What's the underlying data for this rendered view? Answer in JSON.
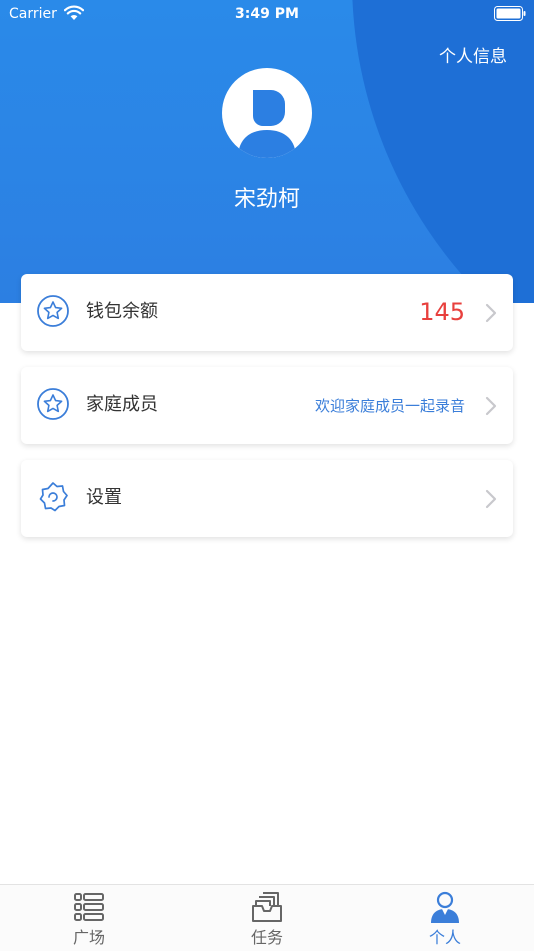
{
  "status_bar": {
    "carrier": "Carrier",
    "time": "3:49 PM"
  },
  "header": {
    "profile_info_link": "个人信息",
    "user_name": "宋劲柯"
  },
  "menu": [
    {
      "label": "钱包余额",
      "value": "145",
      "icon": "star-badge-icon"
    },
    {
      "label": "家庭成员",
      "value": "欢迎家庭成员一起录音",
      "icon": "star-badge-icon"
    },
    {
      "label": "设置",
      "value": "",
      "icon": "gear-icon"
    }
  ],
  "tab_bar": {
    "tabs": [
      {
        "label": "广场",
        "icon": "list-icon",
        "active": false
      },
      {
        "label": "任务",
        "icon": "inbox-stack-icon",
        "active": false
      },
      {
        "label": "个人",
        "icon": "person-icon",
        "active": true
      }
    ]
  },
  "colors": {
    "header_blue": "#2a8ae9",
    "accent_blue": "#3b7ed9",
    "balance_red": "#e8403d",
    "tab_inactive": "#666666"
  }
}
